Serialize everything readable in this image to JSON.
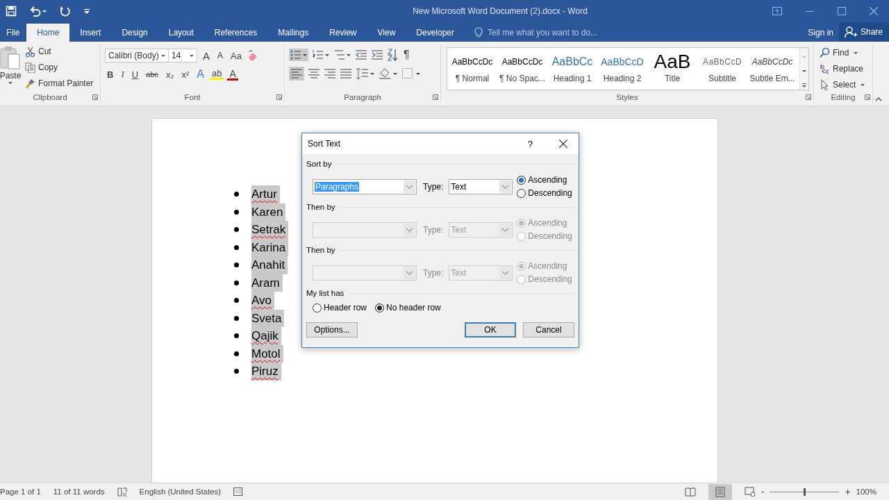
{
  "window": {
    "title": "New Microsoft Word Document (2).docx - Word"
  },
  "tabs": [
    {
      "label": "File",
      "selected": false
    },
    {
      "label": "Home",
      "selected": true
    },
    {
      "label": "Insert",
      "selected": false
    },
    {
      "label": "Design",
      "selected": false
    },
    {
      "label": "Layout",
      "selected": false
    },
    {
      "label": "References",
      "selected": false
    },
    {
      "label": "Mailings",
      "selected": false
    },
    {
      "label": "Review",
      "selected": false
    },
    {
      "label": "View",
      "selected": false
    },
    {
      "label": "Developer",
      "selected": false
    }
  ],
  "tell_me": {
    "placeholder": "Tell me what you want to do..."
  },
  "sign_in": "Sign in",
  "share": "Share",
  "clipboard": {
    "paste": "Paste",
    "items": [
      "Cut",
      "Copy",
      "Format Painter"
    ],
    "label": "Clipboard"
  },
  "font": {
    "font_name": "Calibri (Body)",
    "font_size": "14",
    "size_tools": [
      "A",
      "A",
      "Aa"
    ],
    "format_buttons": [
      "B",
      "I",
      "U",
      "abc",
      "x₂",
      "x²"
    ],
    "color_tools": [
      "A",
      "ab",
      "A"
    ],
    "label": "Font"
  },
  "paragraph": {
    "pilcrow": "¶",
    "label": "Paragraph"
  },
  "styles": {
    "items": [
      {
        "kind": "normal",
        "preview": "AaBbCcDc",
        "name": "¶ Normal"
      },
      {
        "kind": "normal",
        "preview": "AaBbCcDc",
        "name": "¶ No Spac..."
      },
      {
        "kind": "heading1",
        "preview": "AaBbCc",
        "name": "Heading 1"
      },
      {
        "kind": "heading2",
        "preview": "AaBbCcD",
        "name": "Heading 2"
      },
      {
        "kind": "title",
        "preview": "AaB",
        "name": "Title"
      },
      {
        "kind": "subtitle",
        "preview": "AaBbCcD",
        "name": "Subtitle"
      },
      {
        "kind": "emphasis",
        "preview": "AaBbCcDc",
        "name": "Subtle Em..."
      }
    ],
    "label": "Styles"
  },
  "editing": {
    "items": [
      {
        "kind": "find",
        "label": "Find"
      },
      {
        "kind": "replace",
        "label": "Replace"
      },
      {
        "kind": "select",
        "label": "Select"
      }
    ],
    "label": "Editing"
  },
  "document": {
    "items": [
      {
        "text": "Artur",
        "misspelled": true,
        "selected": true
      },
      {
        "text": "Karen",
        "misspelled": false,
        "selected": true
      },
      {
        "text": "Setrak",
        "misspelled": true,
        "selected": true
      },
      {
        "text": "Karina",
        "misspelled": false,
        "selected": true
      },
      {
        "text": "Anahit",
        "misspelled": false,
        "selected": true
      },
      {
        "text": "Aram",
        "misspelled": false,
        "selected": true
      },
      {
        "text": "Avo",
        "misspelled": true,
        "selected": true
      },
      {
        "text": "Sveta",
        "misspelled": false,
        "selected": true
      },
      {
        "text": "Qajik",
        "misspelled": true,
        "selected": true
      },
      {
        "text": "Motol",
        "misspelled": true,
        "selected": true
      },
      {
        "text": "Piruz",
        "misspelled": true,
        "selected": true
      }
    ]
  },
  "dialog": {
    "title": "Sort Text",
    "help": "?",
    "sections": [
      {
        "label": "Sort by",
        "disabled": false,
        "field": "Paragraphs",
        "type_label": "Type:",
        "type_value": "Text",
        "orders": [
          {
            "label": "Ascending",
            "selected": true
          },
          {
            "label": "Descending",
            "selected": false
          }
        ]
      },
      {
        "label": "Then by",
        "disabled": true,
        "type_label": "Type:",
        "type_value": "Text",
        "orders": [
          {
            "label": "Ascending",
            "selected": true
          },
          {
            "label": "Descending",
            "selected": false
          }
        ]
      },
      {
        "label": "Then by",
        "disabled": true,
        "type_label": "Type:",
        "type_value": "Text",
        "orders": [
          {
            "label": "Ascending",
            "selected": true
          },
          {
            "label": "Descending",
            "selected": false
          }
        ]
      }
    ],
    "list_label": "My list has",
    "list_options": [
      {
        "label": "Header row",
        "selected": false
      },
      {
        "label": "No header row",
        "selected": true
      }
    ],
    "buttons": [
      {
        "kind": "options",
        "label": "Options..."
      },
      {
        "kind": "ok",
        "label": "OK"
      },
      {
        "kind": "cancel",
        "label": "Cancel"
      }
    ]
  },
  "status_bar": {
    "page": "Page 1 of 1",
    "words": "11 of 11 words",
    "language": "English (United States)",
    "zoom_minus": "-",
    "zoom_plus": "+",
    "zoom": {
      "level": 0.5
    },
    "zoom_text": "100%"
  }
}
